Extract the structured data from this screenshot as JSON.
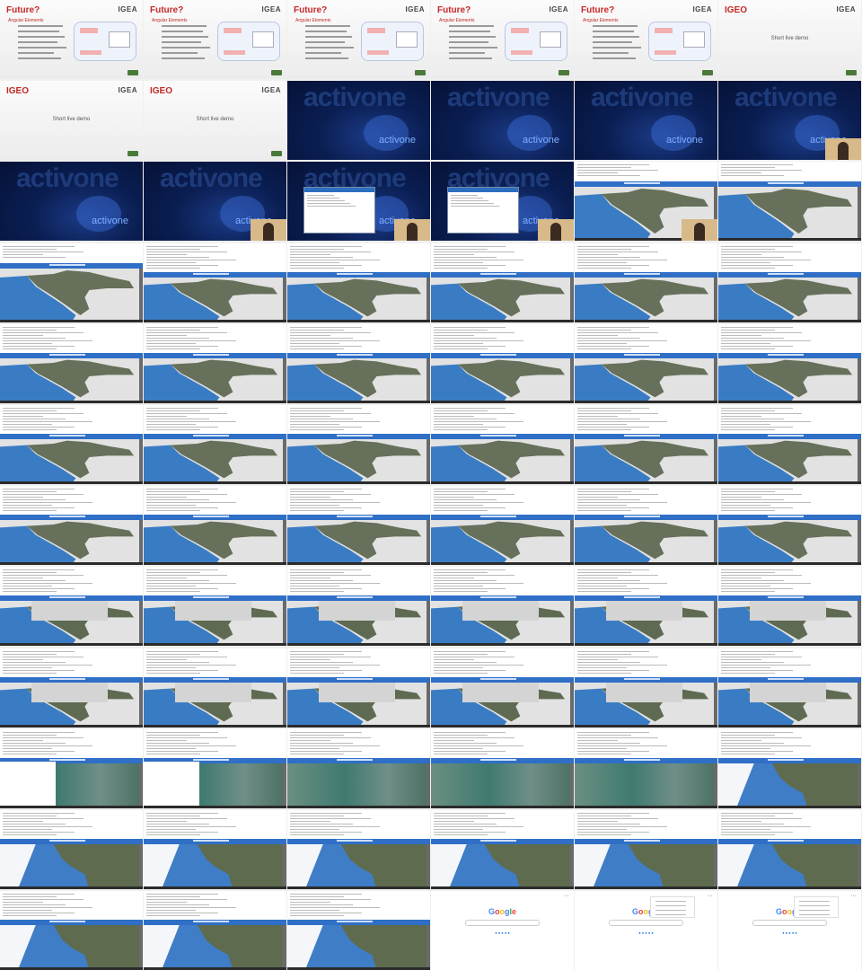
{
  "slides": {
    "future_title": "Future?",
    "angular_subtitle": "Angular Elements",
    "igeo_title": "IGEO",
    "demo_text": "Short live demo",
    "logo_text": "IGEA"
  },
  "activeone": {
    "brand": "activone"
  },
  "google": {
    "logo_letters": [
      {
        "ch": "G",
        "color": "#4285F4"
      },
      {
        "ch": "o",
        "color": "#EA4335"
      },
      {
        "ch": "o",
        "color": "#FBBC05"
      },
      {
        "ch": "g",
        "color": "#4285F4"
      },
      {
        "ch": "l",
        "color": "#34A853"
      },
      {
        "ch": "e",
        "color": "#EA4335"
      }
    ]
  },
  "tiles": [
    {
      "kind": "slide-future"
    },
    {
      "kind": "slide-future"
    },
    {
      "kind": "slide-future"
    },
    {
      "kind": "slide-future"
    },
    {
      "kind": "slide-future"
    },
    {
      "kind": "slide-igeo"
    },
    {
      "kind": "slide-igeo"
    },
    {
      "kind": "slide-igeo"
    },
    {
      "kind": "dark"
    },
    {
      "kind": "dark"
    },
    {
      "kind": "dark"
    },
    {
      "kind": "dark",
      "cam": true
    },
    {
      "kind": "dark"
    },
    {
      "kind": "dark",
      "cam": true
    },
    {
      "kind": "dark",
      "popup": true,
      "cam": true
    },
    {
      "kind": "dark",
      "popup": true,
      "cam": true
    },
    {
      "kind": "app-first",
      "cam": true
    },
    {
      "kind": "app-first"
    },
    {
      "kind": "app-first"
    },
    {
      "kind": "app"
    },
    {
      "kind": "app"
    },
    {
      "kind": "app"
    },
    {
      "kind": "app"
    },
    {
      "kind": "app"
    },
    {
      "kind": "app"
    },
    {
      "kind": "app"
    },
    {
      "kind": "app"
    },
    {
      "kind": "app"
    },
    {
      "kind": "app"
    },
    {
      "kind": "app"
    },
    {
      "kind": "app"
    },
    {
      "kind": "app"
    },
    {
      "kind": "app"
    },
    {
      "kind": "app"
    },
    {
      "kind": "app"
    },
    {
      "kind": "app"
    },
    {
      "kind": "app"
    },
    {
      "kind": "app"
    },
    {
      "kind": "app"
    },
    {
      "kind": "app"
    },
    {
      "kind": "app"
    },
    {
      "kind": "app"
    },
    {
      "kind": "app-zoom"
    },
    {
      "kind": "app-zoom"
    },
    {
      "kind": "app-zoom"
    },
    {
      "kind": "app-zoom"
    },
    {
      "kind": "app-zoom"
    },
    {
      "kind": "app-zoom"
    },
    {
      "kind": "app-zoom"
    },
    {
      "kind": "app-zoom"
    },
    {
      "kind": "app-zoom"
    },
    {
      "kind": "app-zoom"
    },
    {
      "kind": "app-zoom"
    },
    {
      "kind": "app-zoom"
    },
    {
      "kind": "app-sat",
      "white": true
    },
    {
      "kind": "app-sat",
      "white": true
    },
    {
      "kind": "app-sat"
    },
    {
      "kind": "app-sat"
    },
    {
      "kind": "app-sat"
    },
    {
      "kind": "app-coast"
    },
    {
      "kind": "app-istria"
    },
    {
      "kind": "app-istria"
    },
    {
      "kind": "app-istria"
    },
    {
      "kind": "app-istria"
    },
    {
      "kind": "app-istria"
    },
    {
      "kind": "app-istria"
    },
    {
      "kind": "app-istria"
    },
    {
      "kind": "app-istria"
    },
    {
      "kind": "app-istria"
    },
    {
      "kind": "google"
    },
    {
      "kind": "google",
      "menu": true
    },
    {
      "kind": "google",
      "menu": true
    }
  ]
}
